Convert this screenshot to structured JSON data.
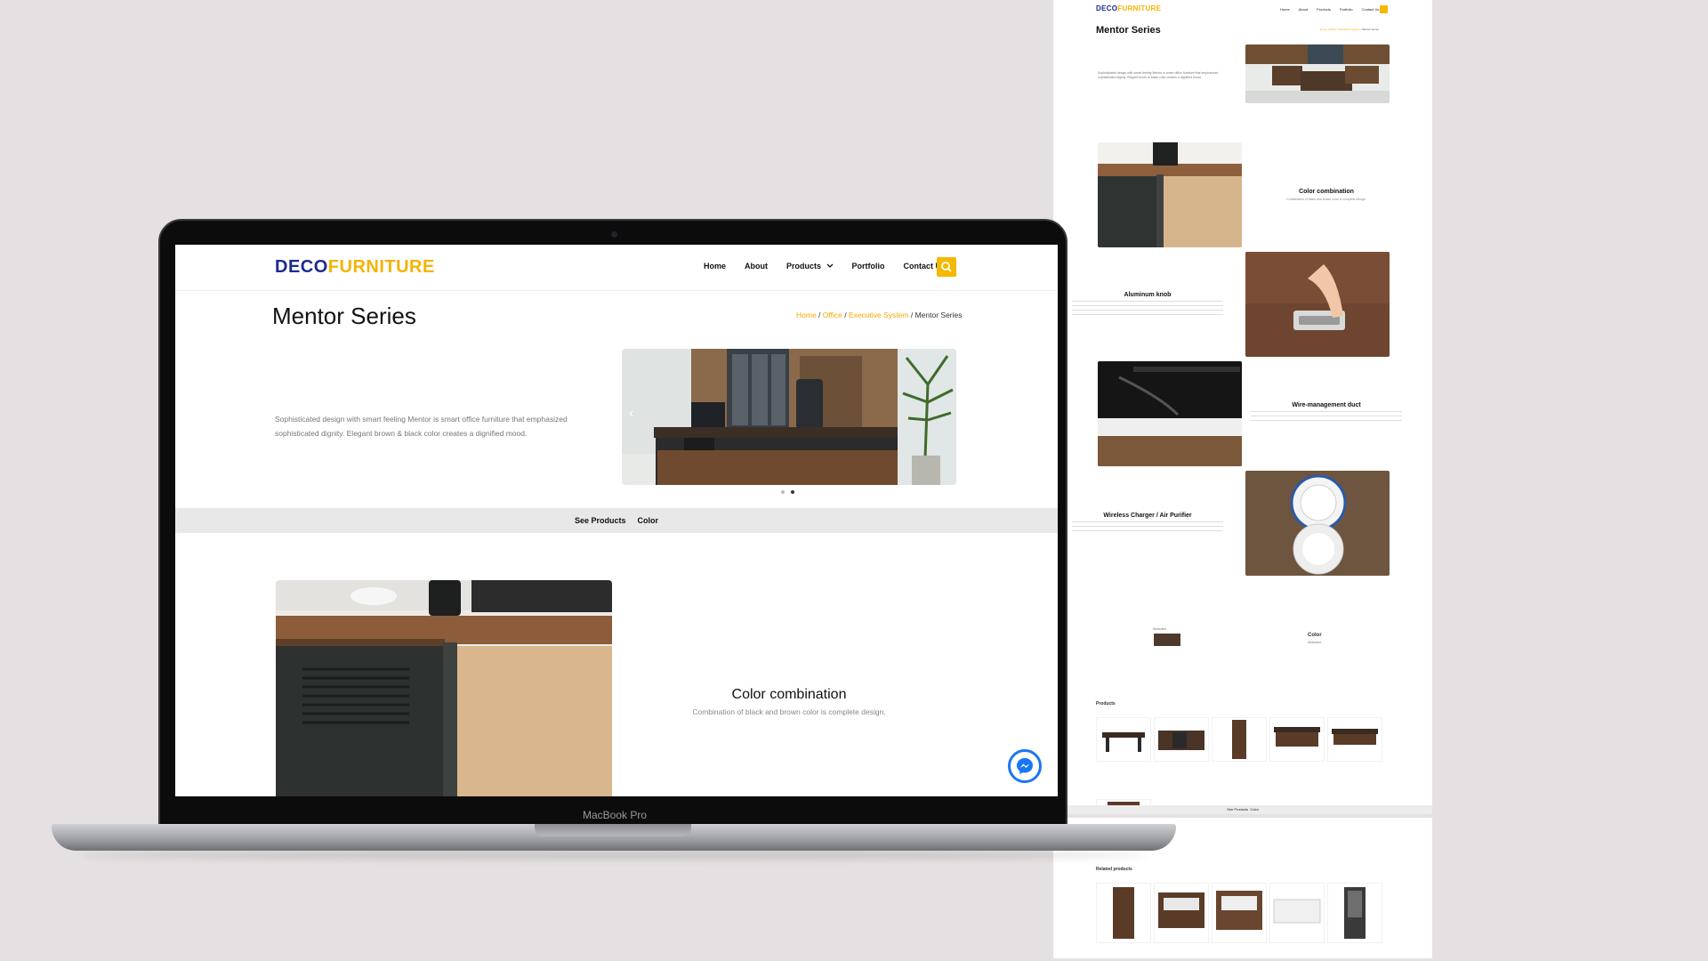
{
  "site": {
    "logo_part1": "DECO",
    "logo_part2": "FURNITURE",
    "nav": {
      "home": "Home",
      "about": "About",
      "products": "Products",
      "portfolio": "Portfolio",
      "contact": "Contact Us"
    },
    "page_title": "Mentor Series",
    "breadcrumb": {
      "home": "Home",
      "office": "Office",
      "executive": "Executive System",
      "current": "Mentor Series"
    },
    "intro": "Sophisticated design with smart feeling Mentor is smart office furniture that emphasized sophisticated dignity. Elegant brown & black color creates a dignified mood.",
    "subnav": {
      "see_products": "See Products",
      "color": "Color"
    },
    "feature": {
      "title": "Color combination",
      "description": "Combination of black and brown color is complete design."
    }
  },
  "laptop_label": "MacBook Pro",
  "preview": {
    "features": [
      {
        "title": "Color combination",
        "description": "Combination of black and brown color is complete design."
      },
      {
        "title": "Aluminum knob"
      },
      {
        "title": "Wire-management duct"
      },
      {
        "title": "Wireless Charger / Air Purifier"
      }
    ],
    "swatch_name": "Melamine",
    "color_heading": "Color",
    "color_sub": "Melamine",
    "products_heading": "Products",
    "related_heading": "Related products",
    "subbar_products": "See Products",
    "subbar_color": "Color"
  },
  "colors": {
    "brand_blue": "#1d2b8f",
    "brand_yellow": "#f5b300",
    "accent": "#f5b800",
    "messenger": "#1877f2"
  },
  "icons": [
    "search-icon",
    "chevron-down-icon",
    "messenger-icon",
    "carousel-prev-icon"
  ],
  "carousel": {
    "slides": 2,
    "active": 2
  }
}
